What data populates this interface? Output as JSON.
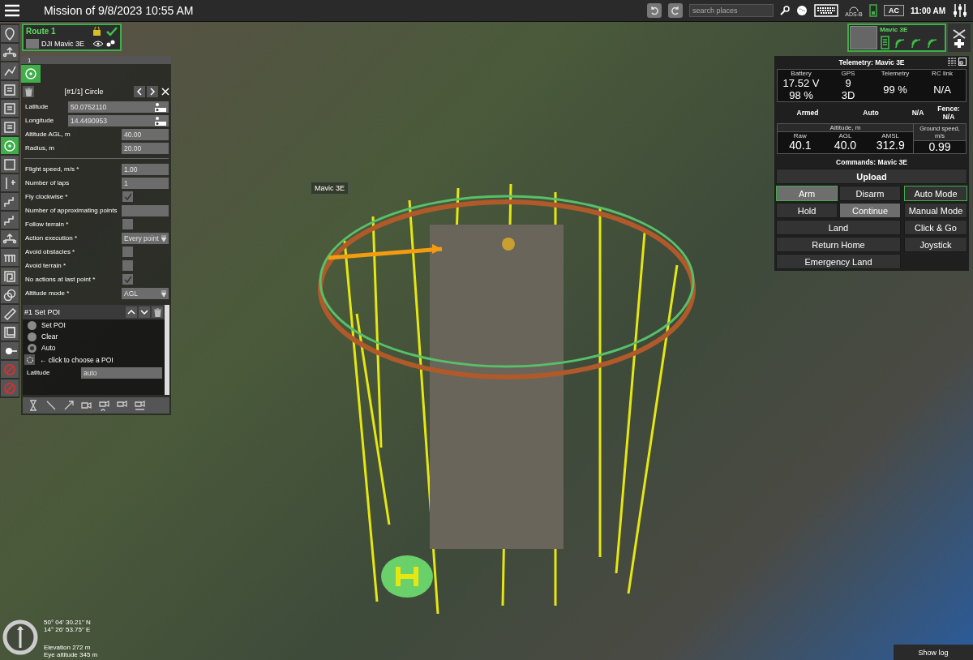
{
  "top_bar": {
    "title": "Mission of 9/8/2023 10:55 AM",
    "search": {
      "placeholder": "search places"
    },
    "adsb": "ADS-B",
    "ac": "AC",
    "time": "11:00 AM"
  },
  "tools": [
    {
      "kind": "waypoint",
      "selected": false
    },
    {
      "kind": "takeoff",
      "selected": false
    },
    {
      "kind": "polyline",
      "selected": false
    },
    {
      "kind": "survey",
      "selected": false
    },
    {
      "kind": "survey",
      "selected": false
    },
    {
      "kind": "survey",
      "selected": false
    },
    {
      "kind": "circle",
      "selected": true
    },
    {
      "kind": "area",
      "selected": false
    },
    {
      "kind": "vertical",
      "selected": false
    },
    {
      "kind": "stairs",
      "selected": false
    },
    {
      "kind": "stairs",
      "selected": false
    },
    {
      "kind": "takeoff",
      "selected": false
    },
    {
      "kind": "facade",
      "selected": false
    },
    {
      "kind": "spiral",
      "selected": false
    },
    {
      "kind": "circles",
      "selected": false
    },
    {
      "kind": "ruler",
      "selected": false
    },
    {
      "kind": "layers",
      "selected": false
    },
    {
      "kind": "sun",
      "selected": false
    },
    {
      "kind": "nofly",
      "selected": false
    },
    {
      "kind": "nofly",
      "selected": false
    }
  ],
  "route": {
    "name": "Route 1",
    "vehicle": "DJI Mavic 3E"
  },
  "segments": [
    {
      "label": "1",
      "selected": true
    }
  ],
  "item": {
    "title": "[#1/1] Circle",
    "fields": [
      {
        "kind": "coord",
        "label": "Latitude",
        "value": "50.0752110"
      },
      {
        "kind": "coord",
        "label": "Longitude",
        "value": "14.4490953"
      },
      {
        "kind": "input",
        "label": "Altitude AGL, m",
        "value": "40.00"
      },
      {
        "kind": "input",
        "label": "Radius, m",
        "value": "20.00"
      },
      {
        "kind": "divider"
      },
      {
        "kind": "input",
        "label": "Flight speed, m/s *",
        "value": "1.00"
      },
      {
        "kind": "input",
        "label": "Number of laps",
        "value": "1"
      },
      {
        "kind": "checkbox",
        "label": "Fly clockwise *",
        "checked": true
      },
      {
        "kind": "input",
        "label": "Number of approximating points"
      },
      {
        "kind": "checkbox",
        "label": "Follow terrain *",
        "checked": false
      },
      {
        "kind": "select",
        "label": "Action execution *",
        "value": "Every point"
      },
      {
        "kind": "checkbox",
        "label": "Avoid obstacles *",
        "checked": false
      },
      {
        "kind": "checkbox",
        "label": "Avoid terrain *",
        "checked": false
      },
      {
        "kind": "checkbox",
        "label": "No actions at last point *",
        "checked": true
      },
      {
        "kind": "select",
        "label": "Altitude mode *",
        "value": "AGL"
      }
    ]
  },
  "action": {
    "title": "#1 Set POI",
    "options": [
      {
        "label": "Set POI",
        "selected": false
      },
      {
        "label": "Clear",
        "selected": false
      },
      {
        "label": "Auto",
        "selected": true
      }
    ],
    "hint": "← click to choose a POI",
    "latitude": {
      "label": "Latitude",
      "placeholder": "auto"
    }
  },
  "vehicle": {
    "name": "Mavic 3E"
  },
  "telemetry": {
    "title": "Telemetry: Mavic 3E",
    "cells": [
      {
        "label": "Battery",
        "values": [
          "17.52 V",
          "98 %"
        ]
      },
      {
        "label": "GPS",
        "values": [
          "9",
          "3D"
        ]
      },
      {
        "label": "Telemetry",
        "values": [
          "99 %"
        ]
      },
      {
        "label": "RC link",
        "values": [
          "N/A"
        ]
      }
    ],
    "status": [
      {
        "text": "Armed"
      },
      {
        "text": "Auto"
      },
      {
        "text": "N/A"
      },
      {
        "text": "Fence: N/A"
      }
    ],
    "altitude": {
      "label": "Altitude, m",
      "cols": [
        {
          "label": "Raw",
          "value": "40.1"
        },
        {
          "label": "AGL",
          "value": "40.0"
        },
        {
          "label": "AMSL",
          "value": "312.9"
        }
      ]
    },
    "ground_speed": {
      "label": "Ground speed, m/s",
      "value": "0.99"
    }
  },
  "commands": {
    "title": "Commands: Mavic 3E",
    "upload": "Upload",
    "left": [
      [
        {
          "label": "Arm",
          "highlighted": true,
          "selected": true
        },
        {
          "label": "Disarm",
          "highlighted": false,
          "selected": false
        }
      ],
      [
        {
          "label": "Hold",
          "highlighted": false,
          "selected": false
        },
        {
          "label": "Continue",
          "highlighted": true,
          "selected": false
        }
      ],
      [
        {
          "label": "Land",
          "highlighted": false,
          "selected": false
        }
      ],
      [
        {
          "label": "Return Home",
          "highlighted": false,
          "selected": false
        }
      ],
      [
        {
          "label": "Emergency Land",
          "highlighted": false,
          "selected": false
        }
      ]
    ],
    "right": [
      {
        "label": "Auto Mode",
        "highlighted": false,
        "selected": true
      },
      {
        "label": "Manual Mode",
        "highlighted": false,
        "selected": false
      },
      {
        "label": "Click & Go",
        "highlighted": false,
        "selected": false
      },
      {
        "label": "Joystick",
        "highlighted": false,
        "selected": false
      }
    ]
  },
  "map": {
    "drone_label": "Mavic 3E",
    "coords": [
      "50° 04' 30.21\" N",
      "14° 26' 53.75\" E"
    ],
    "elevation": "Elevation 272 m",
    "eye_altitude": "Eye altitude 345 m"
  },
  "show_log": "Show log"
}
